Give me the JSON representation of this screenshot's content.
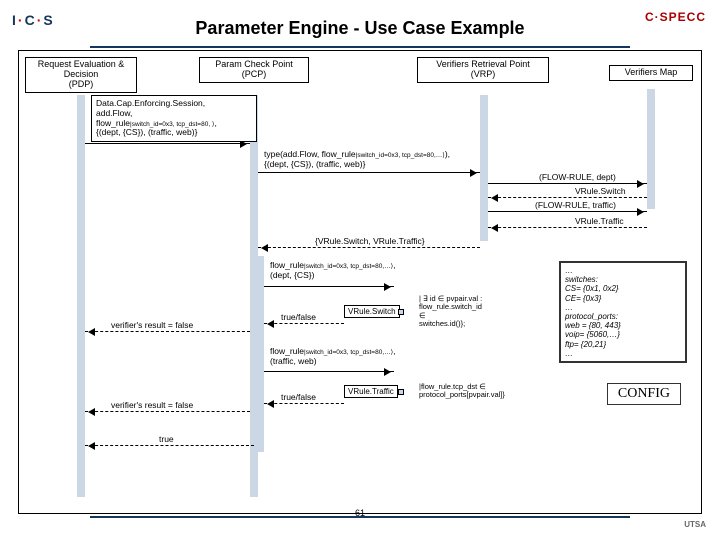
{
  "header": {
    "logo_left_html": "I·C·S",
    "title": "Parameter Engine - Use Case Example",
    "logo_right": "C·SPECC",
    "logo_right_sub": ""
  },
  "heads": {
    "pdp": "Request Evaluation &\nDecision\n(PDP)",
    "pcp": "Param Check Point\n(PCP)",
    "vrp": "Verifiers Retrieval Point\n(VRP)",
    "vmap": "Verifiers Map"
  },
  "msgs": {
    "m1_lines": [
      "Data.Cap.Enforcing.Session,",
      "add.Flow,",
      "flow_rule|switch_id=0x3, tcp_dst=80, ⟩,",
      "{(dept, {CS}), (traffic, web)}"
    ],
    "m2_prefix": "type(add.Flow, ",
    "m2_mid": "flow_rule|switch_id=0x3, tcp_dst=80,…⟩",
    "m2_suffix": "),",
    "m2_line2": "{(dept, {CS}), (traffic, web)}",
    "r1": "(FLOW-RULE, dept)",
    "r2": "VRule.Switch",
    "r3": "(FLOW-RULE, traffic)",
    "r4": "VRule.Traffic",
    "r5": "{VRule.Switch, VRule.Traffic}",
    "fr1_a": "flow_rule|switch_id=0x3, tcp_dst=80,…⟩,",
    "fr1_b": "(dept, {CS})",
    "fr2_a": "flow_rule|switch_id=0x3, tcp_dst=80,…⟩,",
    "fr2_b": "(traffic, web)",
    "tf": "true/false",
    "box_switch": "VRule.Switch",
    "box_traffic": "VRule.Traffic",
    "cond_switch_lines": [
      "| ∃ id ∈ pvpair.val :",
      "flow_rule.switch_id",
      "∈",
      "switches.id()};"
    ],
    "cond_traffic": "|flow_rule.tcp_dst ∈\nprotocol_ports[pvpair.val]}",
    "verres": "verifier's result = false",
    "true": "true"
  },
  "config": {
    "lines": [
      "…",
      "switches:",
      "CS= {0x1, 0x2}",
      "CE= {0x3}",
      "…",
      "protocol_ports:",
      "web = {80, 443}",
      "voip= {5060,…}",
      "ftp= {20,21}",
      "…"
    ],
    "label": "CONFIG"
  },
  "slide_number": "61",
  "footer_right": "UTSA"
}
